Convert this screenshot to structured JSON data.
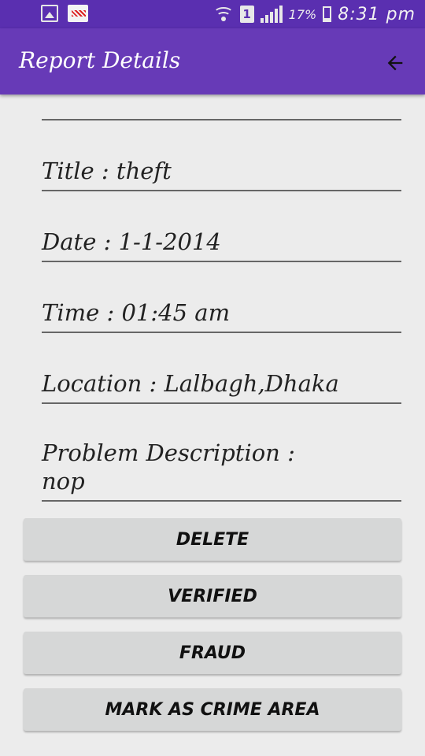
{
  "status_bar": {
    "sim_slot": "1",
    "battery_percent": "17%",
    "time": "8:31 pm",
    "icons": [
      "gallery-icon",
      "app-notification-icon",
      "wifi-icon",
      "sim-icon",
      "signal-icon",
      "battery-icon"
    ]
  },
  "app_bar": {
    "title": "Report Details",
    "back_icon": "arrow-left-icon",
    "color": "#673ab7"
  },
  "fields": {
    "title": "Title : theft",
    "date": "Date : 1-1-2014",
    "time": "Time : 01:45 am",
    "location": "Location : Lalbagh,Dhaka",
    "description": "Problem Description :\nnop"
  },
  "buttons": {
    "delete": "DELETE",
    "verified": "VERIFIED",
    "fraud": "FRAUD",
    "mark_crime_area": "MARK AS CRIME AREA"
  }
}
